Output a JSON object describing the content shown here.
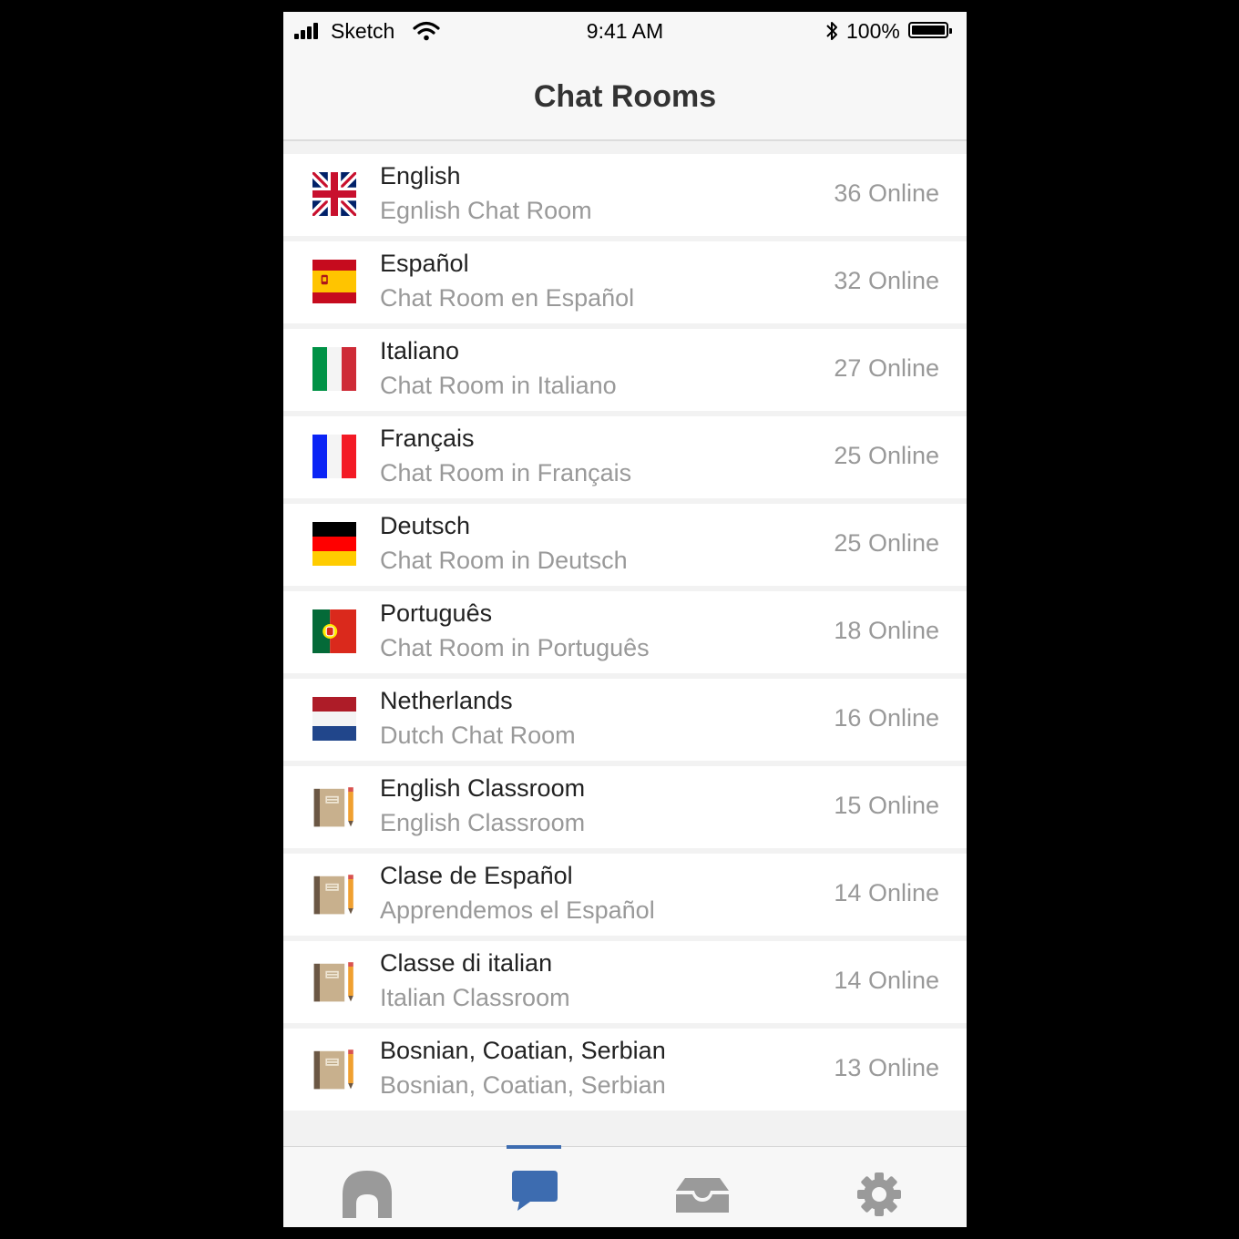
{
  "status_bar": {
    "carrier": "Sketch",
    "time": "9:41 AM",
    "battery": "100%",
    "icons": [
      "signal-icon",
      "wifi-icon",
      "bluetooth-icon",
      "battery-icon"
    ]
  },
  "header": {
    "title": "Chat Rooms"
  },
  "rooms": [
    {
      "title": "English",
      "subtitle": "Egnlish Chat Room",
      "online": "36 Online",
      "icon": "uk-flag-icon"
    },
    {
      "title": "Español",
      "subtitle": "Chat Room en Español",
      "online": "32 Online",
      "icon": "spain-flag-icon"
    },
    {
      "title": "Italiano",
      "subtitle": "Chat Room in Italiano",
      "online": "27 Online",
      "icon": "italy-flag-icon"
    },
    {
      "title": "Français",
      "subtitle": "Chat Room in Français",
      "online": "25 Online",
      "icon": "france-flag-icon"
    },
    {
      "title": "Deutsch",
      "subtitle": "Chat Room in Deutsch",
      "online": "25 Online",
      "icon": "germany-flag-icon"
    },
    {
      "title": "Português",
      "subtitle": "Chat Room in Português",
      "online": "18 Online",
      "icon": "portugal-flag-icon"
    },
    {
      "title": "Netherlands",
      "subtitle": "Dutch Chat Room",
      "online": "16 Online",
      "icon": "netherlands-flag-icon"
    },
    {
      "title": "English Classroom",
      "subtitle": "English Classroom",
      "online": "15 Online",
      "icon": "notebook-pencil-icon"
    },
    {
      "title": "Clase de Español",
      "subtitle": "Apprendemos el Español",
      "online": "14 Online",
      "icon": "notebook-pencil-icon"
    },
    {
      "title": "Classe di italian",
      "subtitle": "Italian Classroom",
      "online": "14 Online",
      "icon": "notebook-pencil-icon"
    },
    {
      "title": "Bosnian, Coatian, Serbian",
      "subtitle": "Bosnian, Coatian, Serbian",
      "online": "13 Online",
      "icon": "notebook-pencil-icon"
    }
  ],
  "tab_bar": {
    "tabs": [
      {
        "icon": "home-icon",
        "active": false
      },
      {
        "icon": "chat-bubble-icon",
        "active": true
      },
      {
        "icon": "inbox-icon",
        "active": false
      },
      {
        "icon": "gear-icon",
        "active": false
      }
    ]
  },
  "colors": {
    "accent": "#3d6cb0",
    "inactive_icon": "#999999",
    "title_text": "#222222",
    "secondary_text": "#999999"
  }
}
